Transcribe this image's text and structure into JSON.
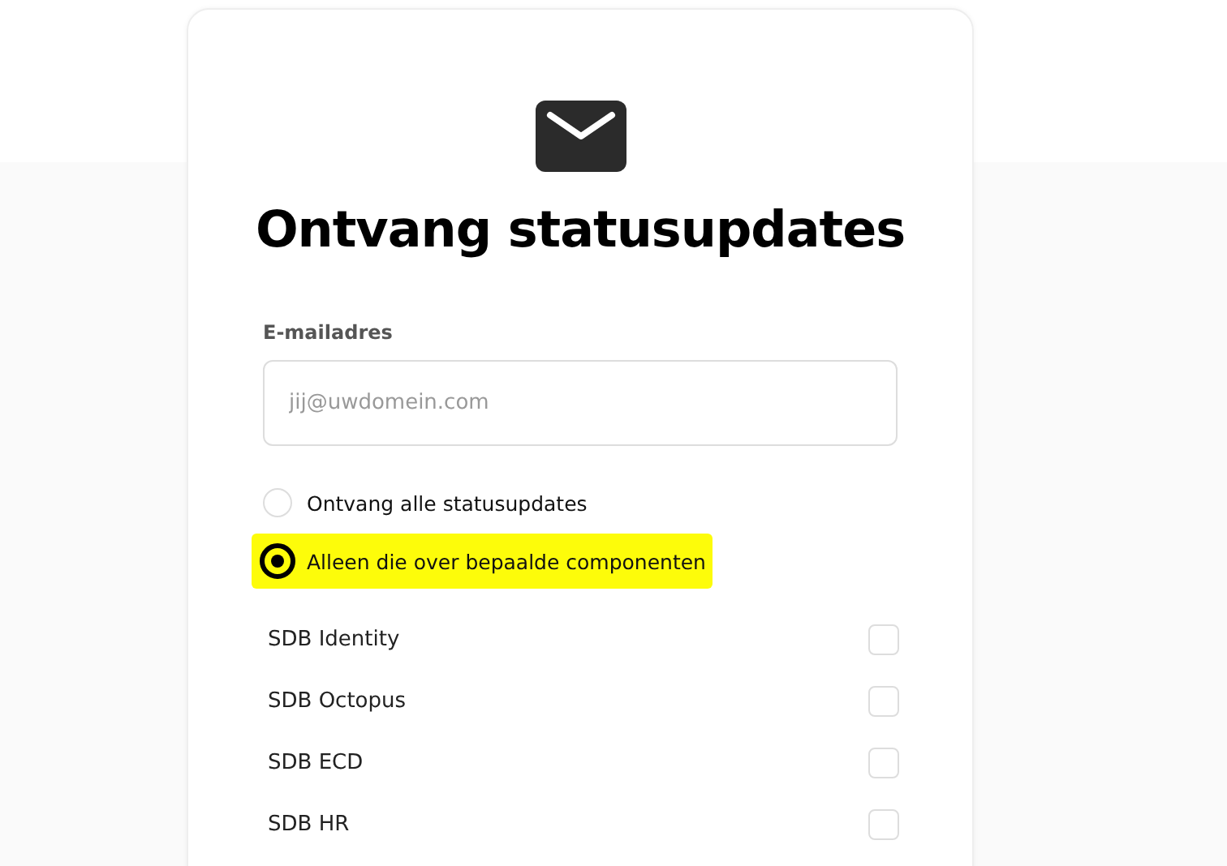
{
  "title": "Ontvang statusupdates",
  "email": {
    "label": "E-mailadres",
    "placeholder": "jij@uwdomein.com"
  },
  "options": [
    {
      "label": "Ontvang alle statusupdates",
      "selected": false,
      "highlighted": false
    },
    {
      "label": "Alleen die over bepaalde componenten",
      "selected": true,
      "highlighted": true
    }
  ],
  "components": [
    {
      "name": "SDB Identity",
      "checked": false
    },
    {
      "name": "SDB Octopus",
      "checked": false
    },
    {
      "name": "SDB ECD",
      "checked": false
    },
    {
      "name": "SDB HR",
      "checked": false
    }
  ]
}
